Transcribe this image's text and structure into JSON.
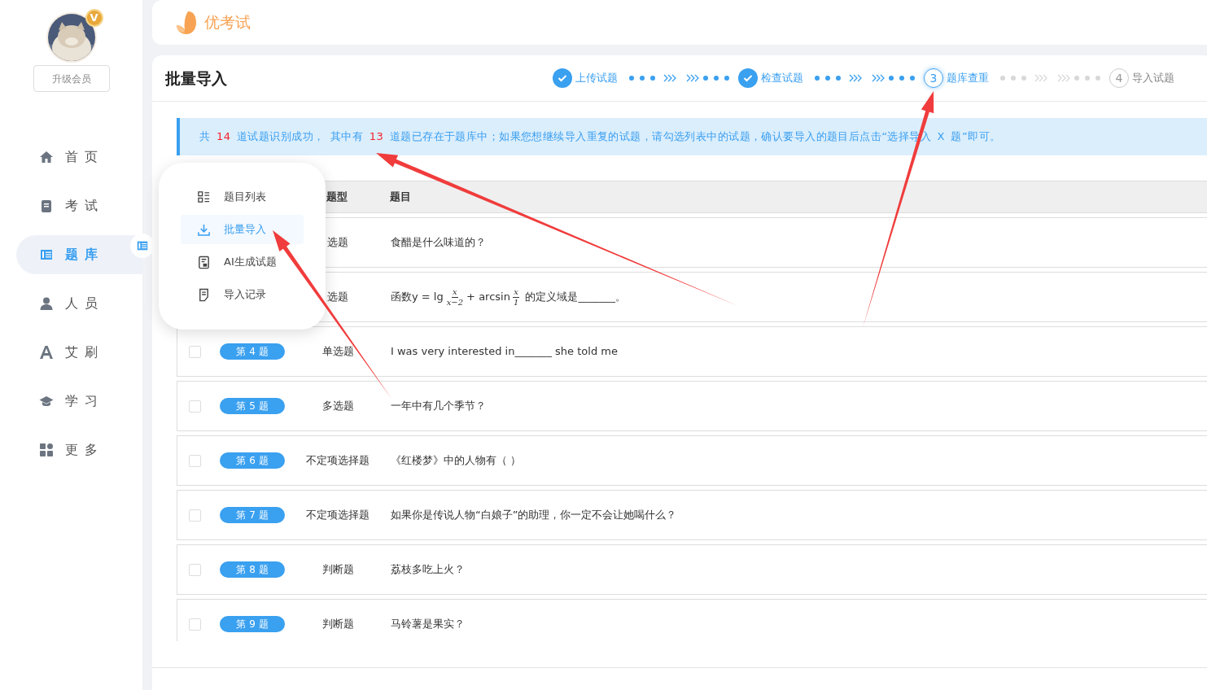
{
  "sidebar": {
    "avatar": {
      "badge": "V"
    },
    "upgrade_button": "升级会员",
    "items": [
      {
        "label": "首页",
        "kind": "home",
        "selected": false
      },
      {
        "label": "考试",
        "kind": "book",
        "selected": false
      },
      {
        "label": "题库",
        "kind": "list",
        "selected": true
      },
      {
        "label": "人员",
        "kind": "person",
        "selected": false
      },
      {
        "label": "艾刷",
        "kind": "letter",
        "selected": false
      },
      {
        "label": "学习",
        "kind": "cap",
        "selected": false
      },
      {
        "label": "更多",
        "kind": "grid",
        "selected": false
      }
    ]
  },
  "header": {
    "logo": "优考试"
  },
  "page": {
    "title": "批量导入",
    "steps": [
      {
        "label": "上传试题",
        "kind": "done"
      },
      {
        "label": "检查试题",
        "kind": "done"
      },
      {
        "label": "题库查重",
        "number": "3",
        "kind": "active"
      },
      {
        "label": "导入试题",
        "number": "4",
        "kind": "pending"
      }
    ],
    "alert": [
      {
        "text": "共 ",
        "highlight": false
      },
      {
        "text": "14",
        "highlight": true
      },
      {
        "text": " 道试题识别成功，  其中有 ",
        "highlight": false
      },
      {
        "text": "13",
        "highlight": true
      },
      {
        "text": " 道题已存在于题库中；如果您想继续导入重复的试题，请勾选列表中的试题，确认要导入的题目后点击“选择导入 X 题”即可。",
        "highlight": false
      }
    ],
    "table": {
      "columns": [
        "题型",
        "题目"
      ],
      "rows": [
        {
          "type": "选题",
          "question": [
            {
              "kind": "text",
              "text": "食醋是什么味道的？"
            }
          ]
        },
        {
          "type": "选题",
          "question": [
            {
              "kind": "text",
              "text": "函数y = lg"
            },
            {
              "kind": "frac",
              "num": "x",
              "den": "x−2"
            },
            {
              "kind": "text",
              "text": "+ arcsin"
            },
            {
              "kind": "frac",
              "num": "x",
              "den": "1"
            },
            {
              "kind": "text",
              "text": " 的定义域是_______。"
            }
          ]
        },
        {
          "checked": false,
          "badge": "第 4 题",
          "type": "单选题",
          "question": [
            {
              "kind": "text",
              "text": "I was very interested in_______ she told me"
            }
          ]
        },
        {
          "checked": false,
          "badge": "第 5 题",
          "type": "多选题",
          "question": [
            {
              "kind": "text",
              "text": "一年中有几个季节？"
            }
          ]
        },
        {
          "checked": false,
          "badge": "第 6 题",
          "type": "不定项选择题",
          "question": [
            {
              "kind": "text",
              "text": "《红楼梦》中的人物有（ ）"
            }
          ]
        },
        {
          "checked": false,
          "badge": "第 7 题",
          "type": "不定项选择题",
          "question": [
            {
              "kind": "text",
              "text": "如果你是传说人物“白娘子”的助理，你一定不会让她喝什么？"
            }
          ]
        },
        {
          "checked": false,
          "badge": "第 8 题",
          "type": "判断题",
          "question": [
            {
              "kind": "text",
              "text": "荔枝多吃上火？"
            }
          ]
        },
        {
          "checked": false,
          "badge": "第 9 题",
          "type": "判断题",
          "question": [
            {
              "kind": "text",
              "text": "马铃薯是果实？"
            }
          ]
        }
      ]
    }
  },
  "popup_menu": {
    "items": [
      {
        "label": "题目列表",
        "kind": "list",
        "selected": false
      },
      {
        "label": "批量导入",
        "kind": "download",
        "selected": true
      },
      {
        "label": "AI生成试题",
        "kind": "doc",
        "selected": false
      },
      {
        "label": "导入记录",
        "kind": "note",
        "selected": false
      }
    ]
  }
}
